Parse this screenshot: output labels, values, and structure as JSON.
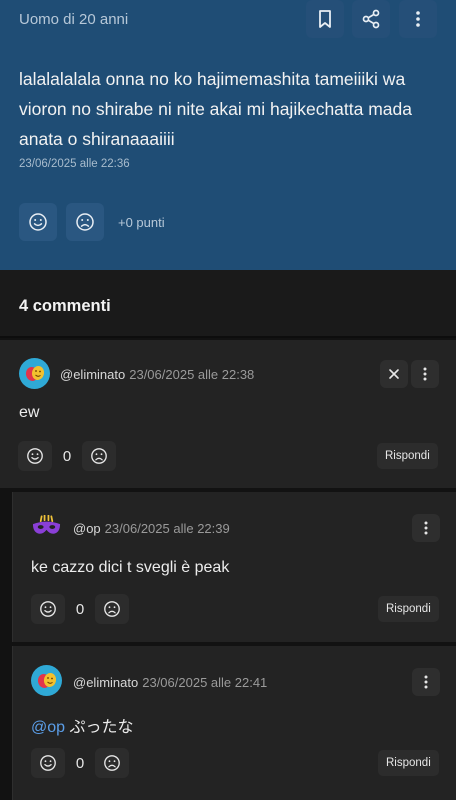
{
  "post": {
    "author": "Uomo di 20 anni",
    "text": "lalalalalala onna no ko hajimemashita tameiiiki wa vioron no shirabe ni nite akai mi hajikechatta mada anata o shiranaaaiiii",
    "timestamp": "23/06/2025 alle 22:36",
    "points": "+0 punti",
    "icons": [
      "bookmark-icon",
      "share-icon",
      "more-vertical-icon",
      "smile-icon",
      "frown-icon"
    ]
  },
  "comments_header": {
    "title": "4 commenti"
  },
  "comments": [
    {
      "user": "@eliminato",
      "timestamp": "23/06/2025 alle 22:38",
      "mention": "",
      "text": "ew",
      "count": "0",
      "reply_label": "Rispondi",
      "avatar": "theater-masks"
    },
    {
      "user": "@op",
      "timestamp": "23/06/2025 alle 22:39",
      "mention": "",
      "text": "ke cazzo dici t svegli è peak",
      "count": "0",
      "reply_label": "Rispondi",
      "avatar": "carnival-mask"
    },
    {
      "user": "@eliminato",
      "timestamp": "23/06/2025 alle 22:41",
      "mention": "@op",
      "text": "ぷったな",
      "count": "0",
      "reply_label": "Rispondi",
      "avatar": "theater-masks"
    }
  ],
  "colors": {
    "post_bg": "#1f4d75",
    "comment_bg": "#232323",
    "page_bg": "#121212",
    "mention": "#5b9ee8"
  }
}
